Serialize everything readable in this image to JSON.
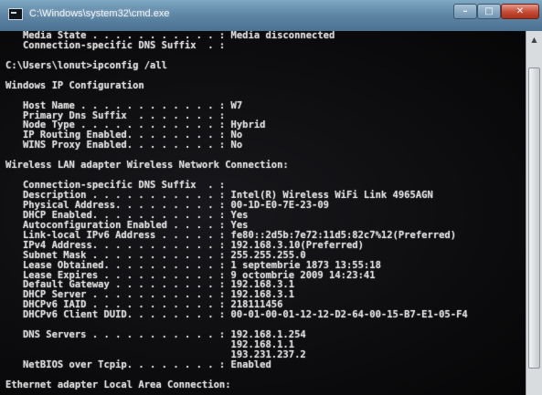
{
  "window": {
    "title": "C:\\Windows\\system32\\cmd.exe",
    "minimize_glyph": "–",
    "maximize_glyph": "□",
    "close_glyph": "✕"
  },
  "console": {
    "lines": [
      "   Media State . . . . . . . . . . . : Media disconnected",
      "   Connection-specific DNS Suffix  . :",
      "",
      "C:\\Users\\lonut>ipconfig /all",
      "",
      "Windows IP Configuration",
      "",
      "   Host Name . . . . . . . . . . . . : W7",
      "   Primary Dns Suffix  . . . . . . . :",
      "   Node Type . . . . . . . . . . . . : Hybrid",
      "   IP Routing Enabled. . . . . . . . : No",
      "   WINS Proxy Enabled. . . . . . . . : No",
      "",
      "Wireless LAN adapter Wireless Network Connection:",
      "",
      "   Connection-specific DNS Suffix  . :",
      "   Description . . . . . . . . . . . : Intel(R) Wireless WiFi Link 4965AGN",
      "   Physical Address. . . . . . . . . : 00-1D-E0-7E-23-09",
      "   DHCP Enabled. . . . . . . . . . . : Yes",
      "   Autoconfiguration Enabled . . . . : Yes",
      "   Link-local IPv6 Address . . . . . : fe80::2d5b:7e72:11d5:82c7%12(Preferred)",
      "   IPv4 Address. . . . . . . . . . . : 192.168.3.10(Preferred)",
      "   Subnet Mask . . . . . . . . . . . : 255.255.255.0",
      "   Lease Obtained. . . . . . . . . . : 1 septembrie 1873 13:55:18",
      "   Lease Expires . . . . . . . . . . : 9 octombrie 2009 14:23:41",
      "   Default Gateway . . . . . . . . . : 192.168.3.1",
      "   DHCP Server . . . . . . . . . . . : 192.168.3.1",
      "   DHCPv6 IAID . . . . . . . . . . . : 218111456",
      "   DHCPv6 Client DUID. . . . . . . . : 00-01-00-01-12-12-D2-64-00-15-B7-E1-05-F4",
      "",
      "   DNS Servers . . . . . . . . . . . : 192.168.1.254",
      "                                       192.168.1.1",
      "                                       193.231.237.2",
      "   NetBIOS over Tcpip. . . . . . . . : Enabled",
      "",
      "Ethernet adapter Local Area Connection:"
    ]
  },
  "scrollbar": {
    "up_glyph": "▲"
  }
}
